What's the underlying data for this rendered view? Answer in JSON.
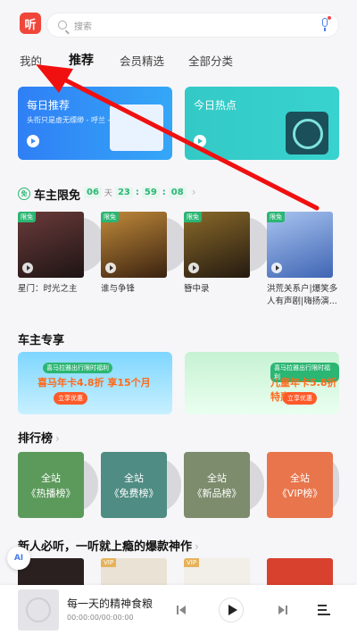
{
  "header": {
    "logo_text": "听",
    "search_placeholder": "搜索"
  },
  "tabs": [
    {
      "label": "我的"
    },
    {
      "label": "推荐"
    },
    {
      "label": "会员精选"
    },
    {
      "label": "全部分类"
    }
  ],
  "banners": [
    {
      "title": "每日推荐",
      "subtitle": "头衔只是虚无缥缈 - 呼兰 -..."
    },
    {
      "title": "今日热点"
    }
  ],
  "free_section": {
    "title": "车主限免",
    "badge": "免",
    "countdown": {
      "days": "06",
      "day_unit": "天",
      "hours": "23",
      "minutes": "59",
      "seconds": "08"
    },
    "books": [
      {
        "tag": "限免",
        "name": "星门：时光之主",
        "color": "#3b2a2a"
      },
      {
        "tag": "限免",
        "name": "谁与争锋",
        "color": "#5a3a1e"
      },
      {
        "tag": "限免",
        "name": "簪中录",
        "color": "#3a2f1a"
      },
      {
        "tag": "限免",
        "name": "洪荒关系户|爆笑多人有声剧|嗨扬演...",
        "color": "#5d7fbf"
      }
    ]
  },
  "owner_section": {
    "title": "车主专享",
    "promos": [
      {
        "top": "喜马拉雅出行限时福利",
        "main": "喜马年卡4.8折 享15个月",
        "btn": "立享优惠"
      },
      {
        "top": "喜马拉雅出行限时福利",
        "main": "儿童年卡5.8折特惠",
        "btn": "立享优惠"
      }
    ]
  },
  "rank_section": {
    "title": "排行榜",
    "items": [
      {
        "line1": "全站",
        "line2": "《热播榜》"
      },
      {
        "line1": "全站",
        "line2": "《免费榜》"
      },
      {
        "line1": "全站",
        "line2": "《新品榜》"
      },
      {
        "line1": "全站",
        "line2": "《VIP榜》"
      }
    ]
  },
  "newbie_section": {
    "title": "新人必听，一听就上瘾的爆款神作",
    "vip_tag": "VIP"
  },
  "ai_label": "AI",
  "player": {
    "title": "每一天的精神食粮",
    "time": "00:00:00/00:00:00"
  }
}
